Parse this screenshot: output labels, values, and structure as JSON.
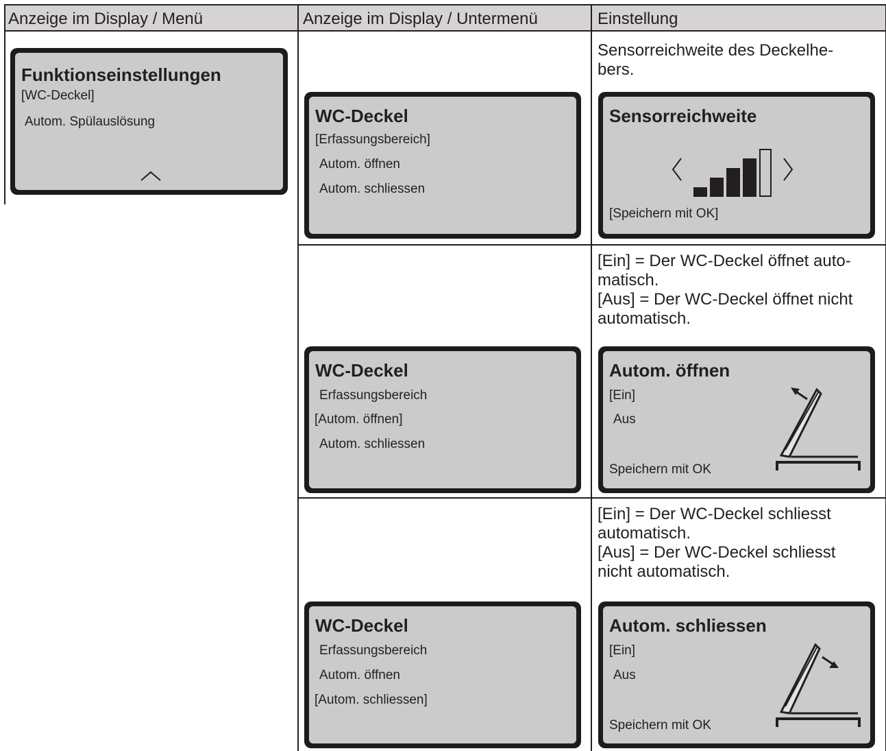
{
  "table": {
    "headers": [
      "Anzeige im Display / Menü",
      "Anzeige im Display / Untermenü",
      "Einstellung"
    ]
  },
  "main_menu": {
    "title": "Funktionseinstellungen",
    "items": [
      "[WC-Deckel]",
      "Autom. Spülauslösung"
    ],
    "scroll_icon": "chevron-up-icon"
  },
  "rows": [
    {
      "submenu": {
        "title": "WC-Deckel",
        "items": [
          "[Erfassungsbereich]",
          "Autom. öffnen",
          "Autom. schliessen"
        ]
      },
      "description": [
        "Sensorreichweite des Deckelhe-",
        "bers."
      ],
      "setting": {
        "title": "Sensorreichweite",
        "level_bars_filled": 4,
        "level_bars_total": 5,
        "footer": "[Speichern mit OK]"
      }
    },
    {
      "submenu": {
        "title": "WC-Deckel",
        "items": [
          "Erfassungsbereich",
          "[Autom. öffnen]",
          "Autom. schliessen"
        ]
      },
      "description": [
        "[Ein] = Der WC-Deckel öffnet auto-",
        "matisch.",
        "[Aus] = Der WC-Deckel öffnet nicht",
        "automatisch."
      ],
      "setting": {
        "title": "Autom. öffnen",
        "options": [
          "[Ein]",
          "Aus"
        ],
        "footer": "Speichern mit OK",
        "illustration": "lid-opening-icon"
      }
    },
    {
      "submenu": {
        "title": "WC-Deckel",
        "items": [
          "Erfassungsbereich",
          "Autom. öffnen",
          "[Autom. schliessen]"
        ]
      },
      "description": [
        "[Ein] = Der WC-Deckel schliesst",
        "automatisch.",
        "[Aus] = Der WC-Deckel schliesst",
        "nicht automatisch."
      ],
      "setting": {
        "title": "Autom. schliessen",
        "options": [
          "[Ein]",
          "Aus"
        ],
        "footer": "Speichern mit OK",
        "illustration": "lid-closing-icon"
      }
    }
  ]
}
